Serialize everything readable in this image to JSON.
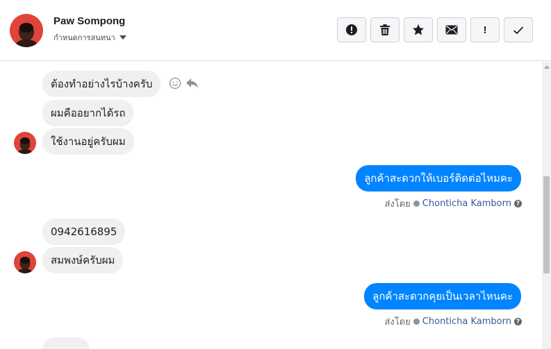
{
  "header": {
    "name": "Paw Sompong",
    "subtitle": "กำหนดการสนทนา"
  },
  "toolbar": {
    "buttons": [
      {
        "icon": "alert-circle-icon"
      },
      {
        "icon": "trash-icon"
      },
      {
        "icon": "star-icon"
      },
      {
        "icon": "envelope-icon"
      },
      {
        "icon": "exclamation-icon",
        "label": "!"
      },
      {
        "icon": "checkmark-icon"
      }
    ]
  },
  "messages": [
    {
      "from": "customer",
      "text": "ต้องทำอย่างไรบ้างครับ"
    },
    {
      "from": "customer",
      "text": "ผมคืออยากได้รถ"
    },
    {
      "from": "customer",
      "text": "ใช้งานอยู่ครับผม"
    },
    {
      "from": "page",
      "text": "ลูกค้าสะดวกให้เบอร์ติดต่อไหมคะ",
      "sent_by_label": "ส่งโดย",
      "sent_by": "Chonticha Kamborn"
    },
    {
      "from": "customer",
      "text": "0942616895"
    },
    {
      "from": "customer",
      "text": "สมพงษ์ครับผม"
    },
    {
      "from": "page",
      "text": "ลูกค้าสะดวกคุยเป็นเวลาไหนคะ",
      "sent_by_label": "ส่งโดย",
      "sent_by": "Chonticha Kamborn"
    }
  ],
  "colors": {
    "outgoing": "#0084ff",
    "incoming": "#f1f0f0",
    "avatar": "#e0433a",
    "link": "#365899"
  }
}
